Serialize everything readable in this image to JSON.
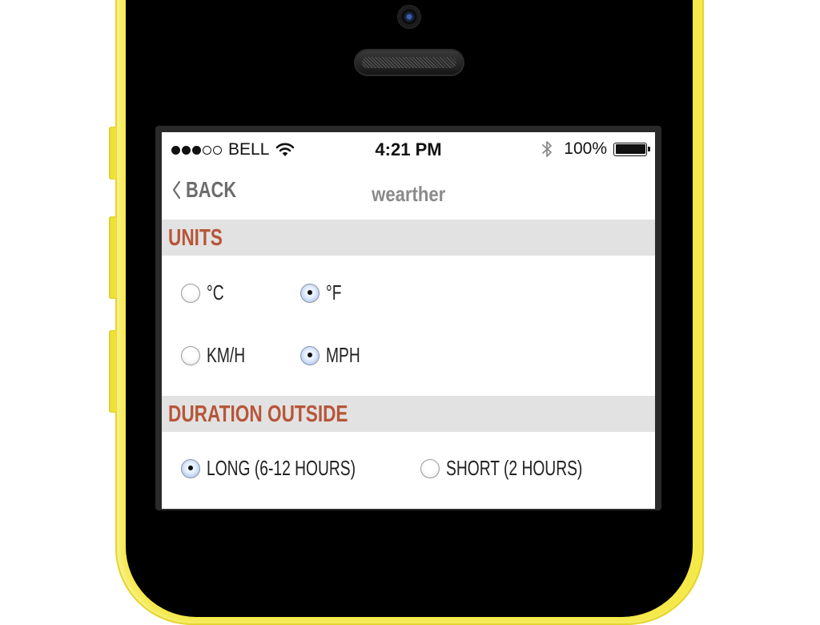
{
  "status_bar": {
    "carrier": "BELL",
    "signal_filled": 3,
    "signal_total": 5,
    "time": "4:21 PM",
    "battery_percent": "100%",
    "battery_level": 1.0
  },
  "nav": {
    "back_label": "BACK",
    "title": "wearther"
  },
  "sections": {
    "units": {
      "title": "UNITS",
      "temperature": [
        {
          "label": "°C",
          "selected": false
        },
        {
          "label": "°F",
          "selected": true
        }
      ],
      "speed": [
        {
          "label": "KM/H",
          "selected": false
        },
        {
          "label": "MPH",
          "selected": true
        }
      ]
    },
    "duration": {
      "title": "DURATION OUTSIDE",
      "options": [
        {
          "label": "LONG (6-12 HOURS)",
          "selected": true
        },
        {
          "label": "SHORT (2 HOURS)",
          "selected": false
        }
      ]
    }
  },
  "colors": {
    "phone_frame": "#f5e94a",
    "section_title": "#b7563a",
    "section_bg": "#e2e2e2",
    "nav_text": "#6c6c6c",
    "radio_selected": "#9cb8e6"
  },
  "icons": {
    "wifi": "wifi-icon",
    "bluetooth": "bluetooth-icon",
    "battery": "battery-icon",
    "back": "chevron-left-icon"
  }
}
